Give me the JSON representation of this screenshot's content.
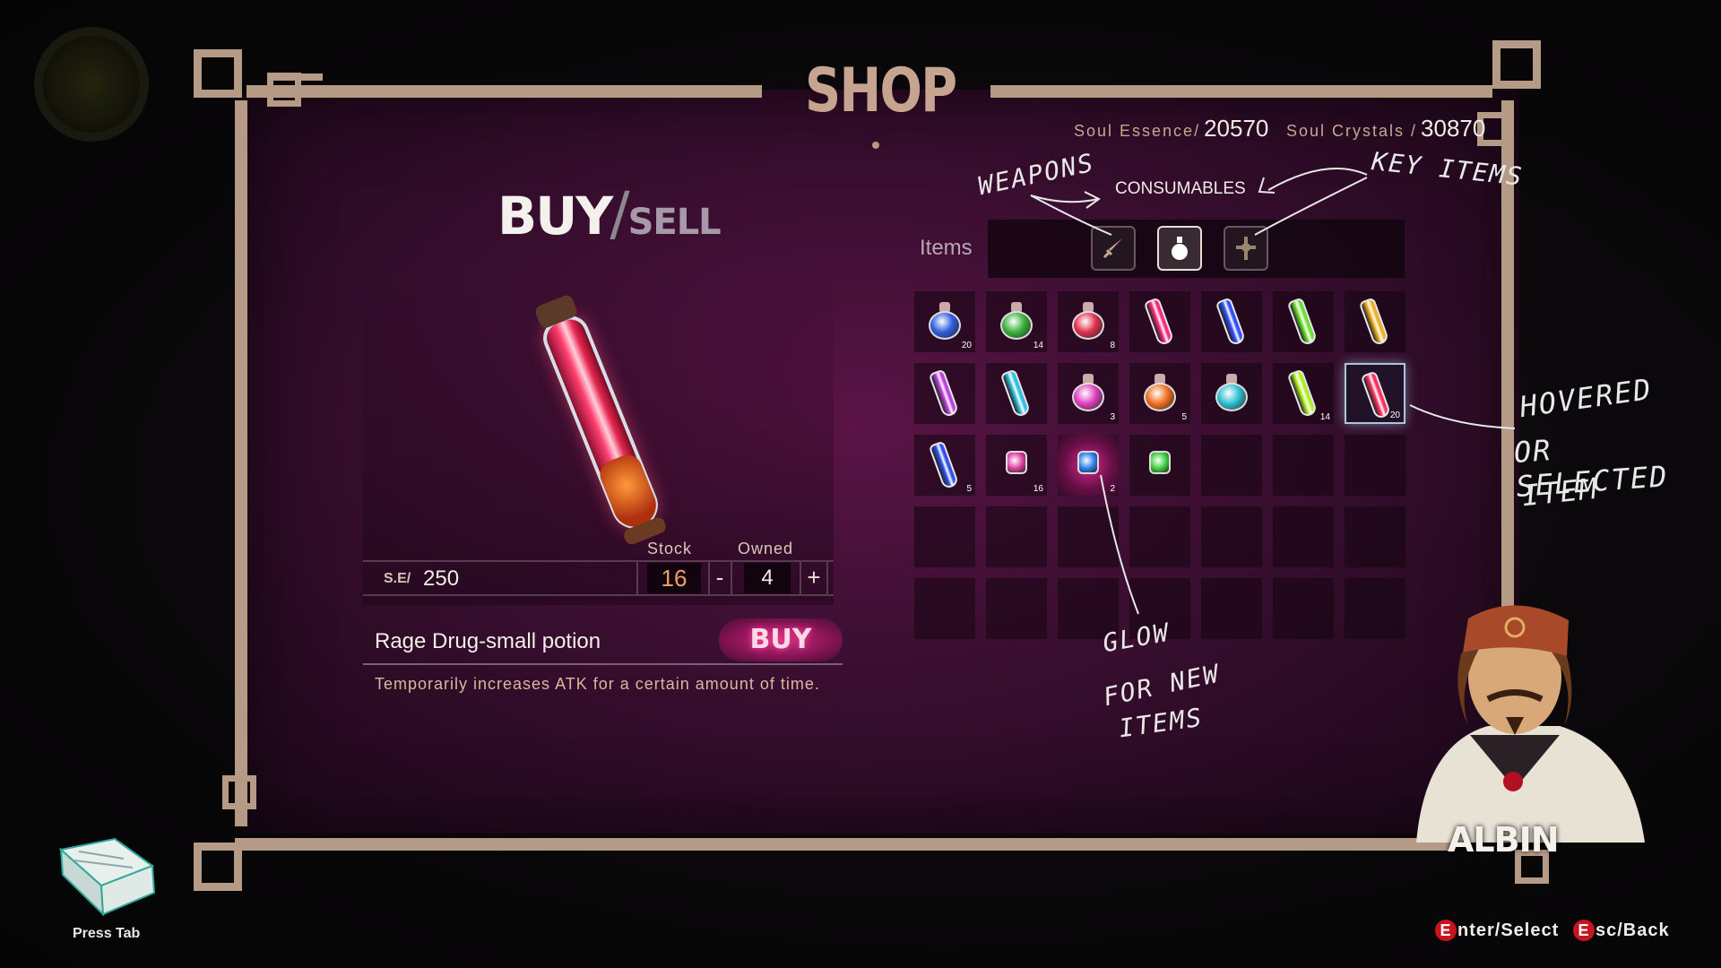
{
  "shop_title": "SHOP",
  "currency": {
    "essence_label": "Soul Essence/",
    "essence_value": "20570",
    "crystals_label": "Soul Crystals /",
    "crystals_value": "30870"
  },
  "mode": {
    "buy": "BUY",
    "slash": "/",
    "sell": "SELL"
  },
  "selected_item": {
    "price_label": "S.E/",
    "price": "250",
    "stock_label": "Stock",
    "stock": "16",
    "owned_label": "Owned",
    "owned": "4",
    "minus": "-",
    "plus": "+",
    "name": "Rage Drug-small potion",
    "buy_label": "BUY",
    "description": "Temporarily increases  ATK  for a certain amount of time."
  },
  "inventory": {
    "items_label": "Items",
    "category_label": "CONSUMABLES",
    "tabs": [
      {
        "name": "weapons",
        "icon": "dagger-icon"
      },
      {
        "name": "consumables",
        "icon": "potion-icon"
      },
      {
        "name": "key-items",
        "icon": "key-cross-icon"
      }
    ],
    "rows": [
      [
        {
          "type": "flask",
          "color": "#2f5fe0",
          "qty": "20"
        },
        {
          "type": "flask",
          "color": "#3cb33c",
          "qty": "14"
        },
        {
          "type": "flask",
          "color": "#e0304e",
          "qty": "8"
        },
        {
          "type": "vial",
          "color": "#ff2a7a",
          "qty": ""
        },
        {
          "type": "vial",
          "color": "#3050ff",
          "qty": ""
        },
        {
          "type": "vial",
          "color": "#6ee030",
          "qty": ""
        },
        {
          "type": "vial",
          "color": "#f0b020",
          "qty": ""
        }
      ],
      [
        {
          "type": "vial",
          "color": "#c040e0",
          "qty": ""
        },
        {
          "type": "vial",
          "color": "#30c0e0",
          "qty": ""
        },
        {
          "type": "flask",
          "color": "#e040c0",
          "qty": "3"
        },
        {
          "type": "flask",
          "color": "#f07020",
          "qty": "5"
        },
        {
          "type": "flask",
          "color": "#30c0d0",
          "qty": ""
        },
        {
          "type": "vial",
          "color": "#b0f020",
          "qty": "14"
        },
        {
          "type": "vial",
          "color": "#ff3060",
          "qty": "20",
          "selected": true
        }
      ],
      [
        {
          "type": "vial",
          "color": "#3050f0",
          "qty": "5"
        },
        {
          "type": "small",
          "color": "#e040a0",
          "qty": "16"
        },
        {
          "type": "small",
          "color": "#3080f0",
          "qty": "2",
          "glow": true
        },
        {
          "type": "small",
          "color": "#40d040",
          "qty": ""
        },
        {
          "type": "empty"
        },
        {
          "type": "empty"
        },
        {
          "type": "empty"
        }
      ],
      [
        {
          "type": "empty"
        },
        {
          "type": "empty"
        },
        {
          "type": "empty"
        },
        {
          "type": "empty"
        },
        {
          "type": "empty"
        },
        {
          "type": "empty"
        },
        {
          "type": "empty"
        }
      ],
      [
        {
          "type": "empty"
        },
        {
          "type": "empty"
        },
        {
          "type": "empty"
        },
        {
          "type": "empty"
        },
        {
          "type": "empty"
        },
        {
          "type": "empty"
        },
        {
          "type": "empty"
        }
      ]
    ]
  },
  "annotations": {
    "weapons": "WEAPONS",
    "key_items": "KEY ITEMS",
    "hovered_1": "HOVERED",
    "hovered_2": "OR SELECTED",
    "hovered_3": "ITEM",
    "glow_1": "GLOW",
    "glow_2": "FOR NEW",
    "glow_3": "ITEMS"
  },
  "npc_name": "ALBIN",
  "help": {
    "enter_key": "E",
    "enter_text": "nter/Select",
    "esc_key": "E",
    "esc_text": "sc/Back"
  },
  "press_tab": "Press Tab",
  "colors": {
    "frame": "#b59a86",
    "panel": "#3f0f34",
    "accent_buy": "#c2307a",
    "stock_number": "#f0a060"
  }
}
